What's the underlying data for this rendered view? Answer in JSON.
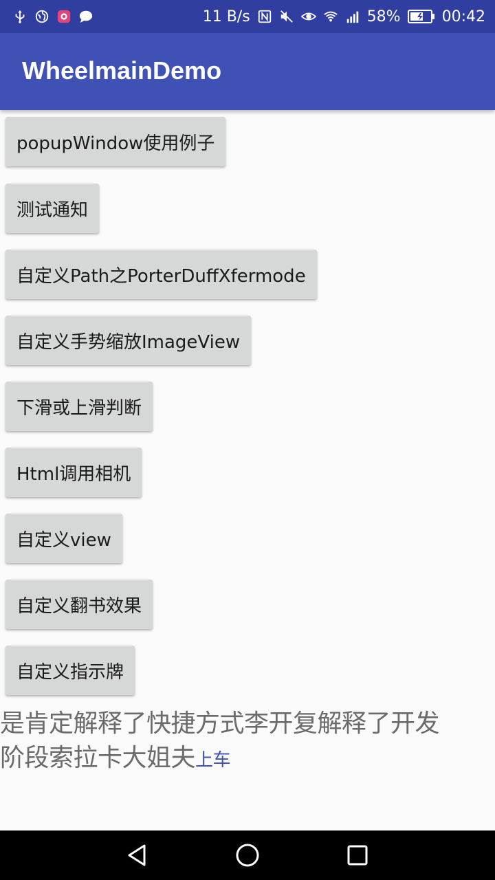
{
  "status_bar": {
    "speed": "11 B/s",
    "battery": "58%",
    "time": "00:42",
    "left_icons": [
      "usb-icon",
      "globe-icon",
      "app-notification-icon",
      "chat-icon"
    ],
    "right_icons": [
      "nfc-icon",
      "mute-icon",
      "eye-icon",
      "wifi-icon",
      "signal-4g-icon",
      "battery-icon"
    ]
  },
  "app_bar": {
    "title": "WheelmainDemo"
  },
  "buttons": [
    {
      "label": "popupWindow使用例子"
    },
    {
      "label": "测试通知"
    },
    {
      "label": "自定义Path之PorterDuffXfermode"
    },
    {
      "label": "自定义手势缩放ImageView"
    },
    {
      "label": "下滑或上滑判断"
    },
    {
      "label": "Html调用相机"
    },
    {
      "label": "自定义view"
    },
    {
      "label": "自定义翻书效果"
    },
    {
      "label": "自定义指示牌"
    }
  ],
  "text_content": {
    "line1": "是肯定解释了快捷方式李开复解释了开发",
    "line2": "阶段索拉卡大姐夫",
    "link": "上车"
  },
  "nav_bar": {
    "icons": [
      "back-icon",
      "home-icon",
      "recents-icon"
    ]
  },
  "colors": {
    "primary": "#3f51b5",
    "primary_dark": "#303f9f",
    "button": "#d6d7d7"
  }
}
